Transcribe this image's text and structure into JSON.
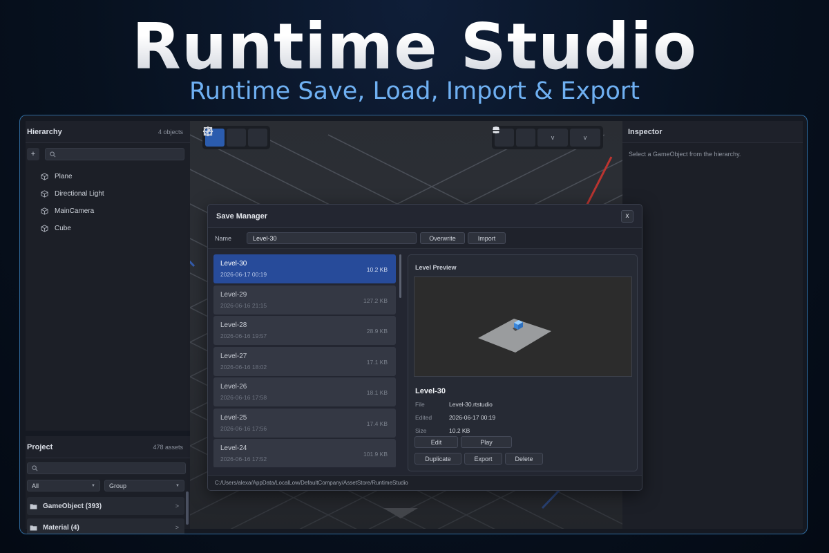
{
  "hero": {
    "title": "Runtime Studio",
    "subtitle": "Runtime Save, Load, Import & Export"
  },
  "hierarchy": {
    "title": "Hierarchy",
    "count": "4 objects",
    "add_label": "+",
    "items": [
      {
        "label": "Plane"
      },
      {
        "label": "Directional Light"
      },
      {
        "label": "MainCamera"
      },
      {
        "label": "Cube"
      }
    ]
  },
  "project": {
    "title": "Project",
    "count": "478 assets",
    "filter_type": "All",
    "filter_group": "Group",
    "folders": [
      {
        "label": "GameObject (393)"
      },
      {
        "label": "Material (4)"
      }
    ]
  },
  "inspector": {
    "title": "Inspector",
    "hint": "Select a GameObject from the hierarchy."
  },
  "toolbar": {
    "tools": [
      "move-tool-icon",
      "rotate-tool-icon",
      "scale-tool-icon"
    ],
    "active_tool": "move",
    "dropdown_arrow": "v"
  },
  "save_manager": {
    "title": "Save Manager",
    "close_label": "x",
    "name_label": "Name",
    "name_value": "Level-30",
    "overwrite_label": "Overwrite",
    "import_label": "Import",
    "saves": [
      {
        "name": "Level-30",
        "date": "2026-06-17 00:19",
        "size": "10.2 KB",
        "selected": true
      },
      {
        "name": "Level-29",
        "date": "2026-06-16 21:15",
        "size": "127.2 KB"
      },
      {
        "name": "Level-28",
        "date": "2026-06-16 19:57",
        "size": "28.9 KB"
      },
      {
        "name": "Level-27",
        "date": "2026-06-16 18:02",
        "size": "17.1 KB"
      },
      {
        "name": "Level-26",
        "date": "2026-06-16 17:58",
        "size": "18.1 KB"
      },
      {
        "name": "Level-25",
        "date": "2026-06-16 17:56",
        "size": "17.4 KB"
      },
      {
        "name": "Level-24",
        "date": "2026-06-16 17:52",
        "size": "101.9 KB"
      }
    ],
    "preview": {
      "label": "Level Preview",
      "name": "Level-30",
      "file_key": "File",
      "file_value": "Level-30.rtstudio",
      "edited_key": "Edited",
      "edited_value": "2026-06-17 00:19",
      "size_key": "Size",
      "size_value": "10.2 KB",
      "edit_label": "Edit",
      "play_label": "Play",
      "duplicate_label": "Duplicate",
      "export_label": "Export",
      "delete_label": "Delete"
    },
    "path": "C:/Users/alexa/AppData/LocalLow/DefaultCompany/AssetStore/RuntimeStudio"
  },
  "colors": {
    "accent": "#2b5cae",
    "selected_row": "#274b9a",
    "subtitle": "#6fb0f2",
    "frame_border": "#2f6a9d"
  }
}
